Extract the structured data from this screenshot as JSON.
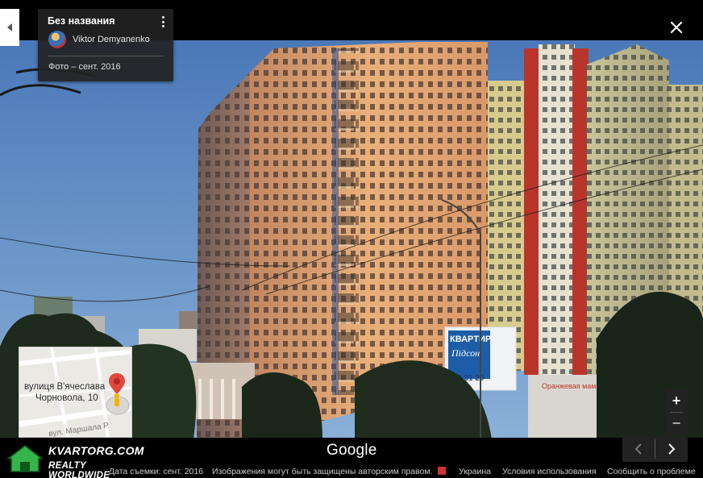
{
  "panorama": {
    "title": "Без названия",
    "author": "Viktor Demyanenko",
    "photo_date": "Фото – сент. 2016"
  },
  "minimap": {
    "place_line1": "вулиця В'ячеслава",
    "place_line2": "Чорновола, 10",
    "street": "вул. Маршала Р"
  },
  "billboard": {
    "line1": "КВАРТИР",
    "line2": "Підсон",
    "line3": "593 31 20"
  },
  "shop_sign": "Оранжевая мамы",
  "controls": {
    "zoom_in": "+",
    "zoom_out": "−",
    "logo": "Google"
  },
  "footer": {
    "capture_date": "Дата съемки: сент. 2016",
    "copyright": "Изображения могут быть защищены авторским правом.",
    "country": "Украина",
    "terms": "Условия использования",
    "report": "Сообщить о проблеме"
  },
  "watermark": {
    "line1": "KVARTORG.COM",
    "line2": "REALTY  WORLDWIDE"
  },
  "colors": {
    "sky_top": "#4a78b8",
    "sky_bottom": "#8ab0d8",
    "tower_lit": "#e8a060",
    "tower_shade": "#8a6a58",
    "accent_red": "#c0392b",
    "foliage": "#1d2a1c"
  },
  "icons": {
    "collapse": "chevron-left-icon",
    "close": "close-icon",
    "menu": "more-vert-icon",
    "pegman": "pegman-icon",
    "prev": "chevron-left-icon",
    "next": "chevron-right-icon"
  }
}
